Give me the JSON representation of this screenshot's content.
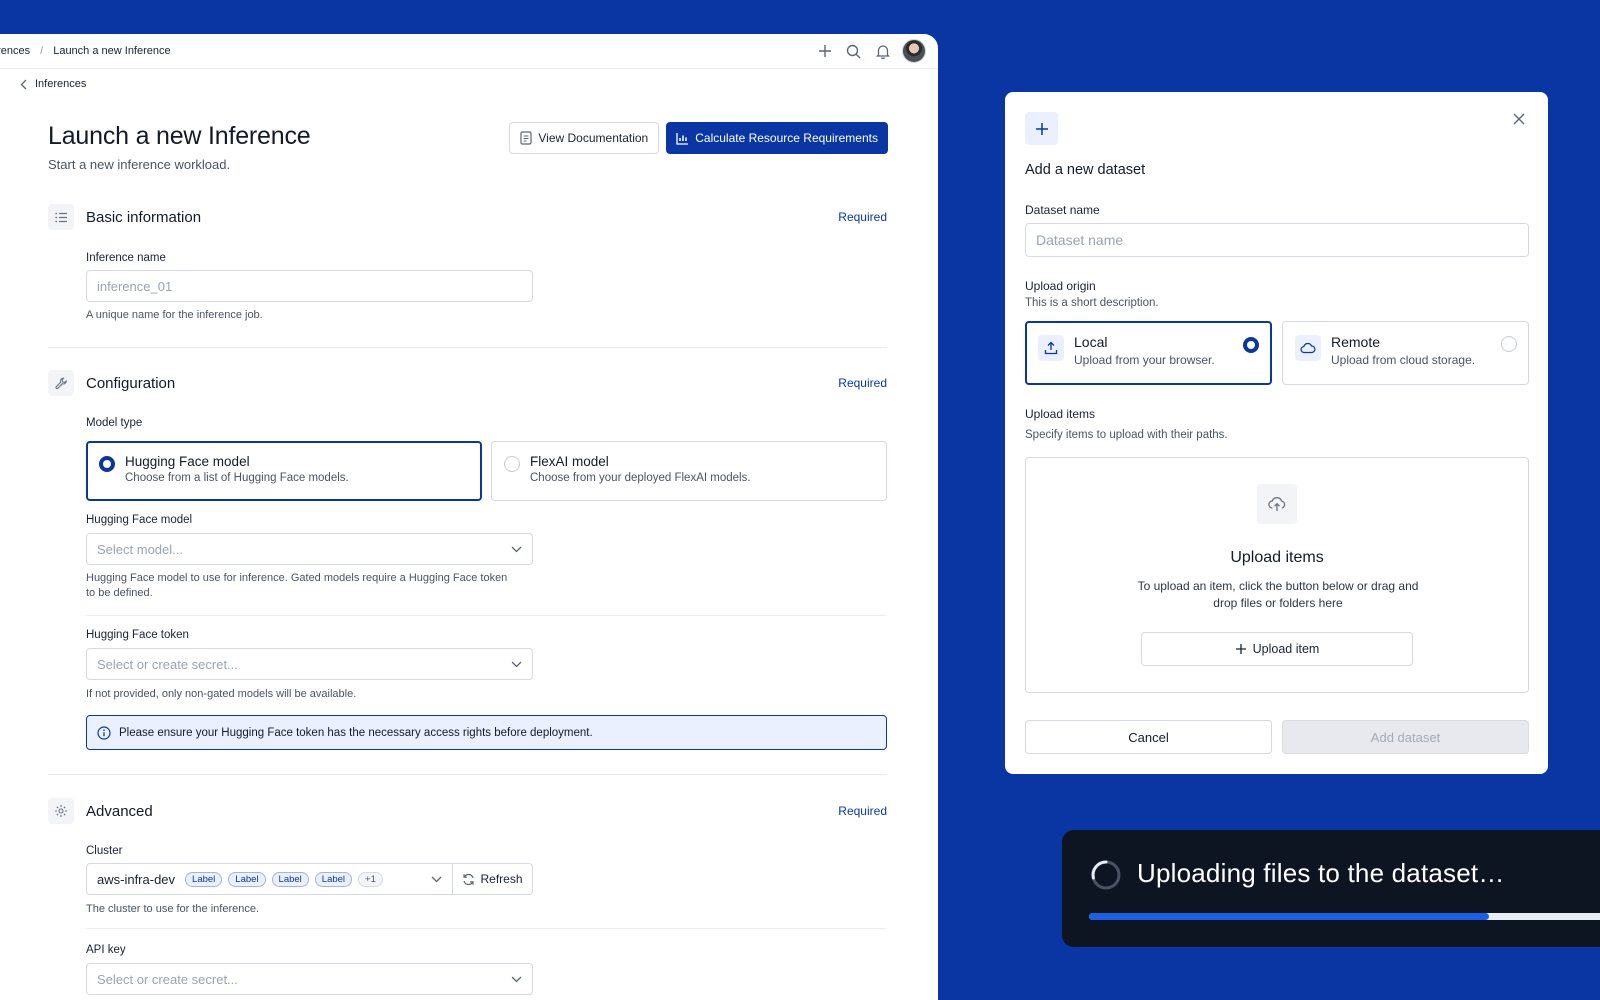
{
  "breadcrumb": {
    "parent": "erences",
    "current": "Launch a new Inference"
  },
  "back_link": "Inferences",
  "page": {
    "title": "Launch a new Inference",
    "subtitle": "Start a new inference workload."
  },
  "header_buttons": {
    "docs": "View Documentation",
    "calc": "Calculate Resource Requirements"
  },
  "basic": {
    "title": "Basic information",
    "required": "Required",
    "name_label": "Inference name",
    "name_placeholder": "inference_01",
    "name_help": "A unique name for the inference job."
  },
  "config": {
    "title": "Configuration",
    "required": "Required",
    "model_type_label": "Model type",
    "hf_option": {
      "title": "Hugging Face model",
      "desc": "Choose from a list of Hugging Face models."
    },
    "flex_option": {
      "title": "FlexAI model",
      "desc": "Choose from your deployed FlexAI models."
    },
    "hf_model_label": "Hugging Face model",
    "hf_model_placeholder": "Select model...",
    "hf_model_help": "Hugging Face model to use for inference. Gated models require a Hugging Face token to be defined.",
    "hf_token_label": "Hugging Face token",
    "hf_token_placeholder": "Select or create secret...",
    "hf_token_help": "If not provided, only non-gated models will be available.",
    "info": "Please ensure your Hugging Face token has the necessary access rights before deployment."
  },
  "advanced": {
    "title": "Advanced",
    "required": "Required",
    "cluster_label": "Cluster",
    "cluster_value": "aws-infra-dev",
    "chips": [
      "Label",
      "Label",
      "Label",
      "Label"
    ],
    "chip_more": "+1",
    "refresh": "Refresh",
    "cluster_help": "The cluster to use for the inference.",
    "api_key_label": "API key",
    "api_key_placeholder": "Select or create secret..."
  },
  "modal": {
    "title": "Add a new dataset",
    "name_label": "Dataset name",
    "name_placeholder": "Dataset name",
    "origin_label": "Upload origin",
    "origin_desc": "This is a short description.",
    "local": {
      "title": "Local",
      "desc": "Upload from your browser."
    },
    "remote": {
      "title": "Remote",
      "desc": "Upload from cloud storage."
    },
    "items_label": "Upload items",
    "items_desc": "Specify items to upload with their paths.",
    "dropzone_title": "Upload items",
    "dropzone_text": "To upload an item, click the button below or drag and drop files or folders here",
    "upload_button": "Upload item",
    "cancel": "Cancel",
    "add": "Add dataset"
  },
  "toast": {
    "text": "Uploading files to the dataset…",
    "progress": 0.75
  },
  "colors": {
    "brand": "#0a36a3",
    "toast_bg": "#0d1422",
    "progress": "#1c5fe0"
  }
}
